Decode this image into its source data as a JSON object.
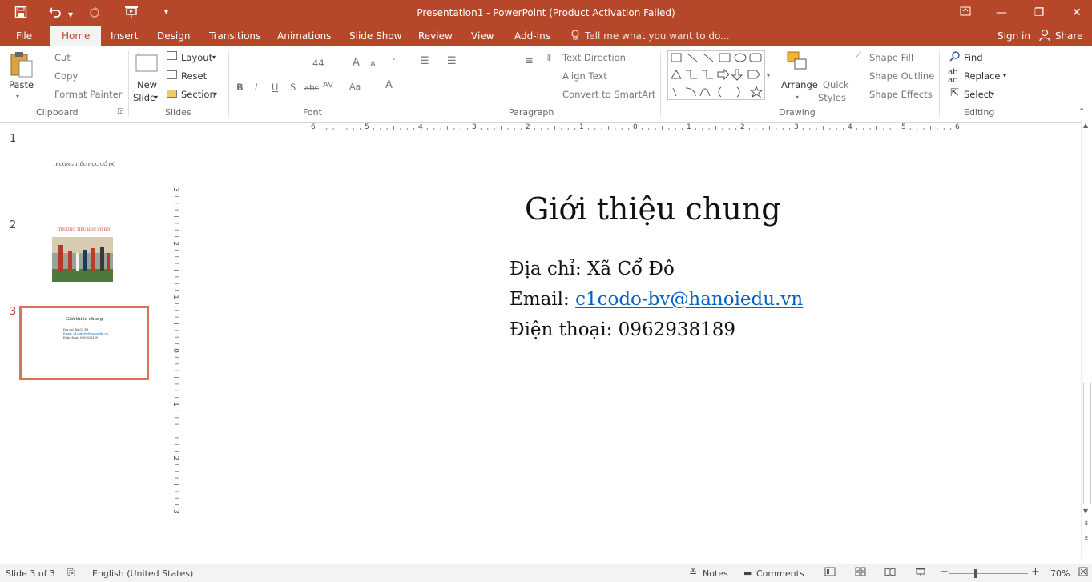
{
  "window": {
    "title": "Presentation1 - PowerPoint (Product Activation Failed)"
  },
  "quick_access": {
    "save_icon": "save-icon",
    "undo_icon": "undo-icon",
    "redo_icon": "redo-icon",
    "present_icon": "present-icon",
    "customize_icon": "chevron-down-icon"
  },
  "tabs": [
    "File",
    "Home",
    "Insert",
    "Design",
    "Transitions",
    "Animations",
    "Slide Show",
    "Review",
    "View",
    "Add-Ins"
  ],
  "tell_me": "Tell me what you want to do...",
  "sign_in": "Sign in",
  "share": "Share",
  "ribbon": {
    "clipboard": {
      "paste": "Paste",
      "cut": "Cut",
      "copy": "Copy",
      "format_painter": "Format Painter",
      "label": "Clipboard"
    },
    "slides": {
      "new": "New",
      "slide": "Slide",
      "layout": "Layout",
      "reset": "Reset",
      "section": "Section",
      "label": "Slides"
    },
    "font": {
      "size": "44",
      "label": "Font",
      "bold": "B",
      "italic": "I",
      "underline": "U",
      "shadow": "S",
      "strike": "abc",
      "spacing": "AV",
      "case": "Aa",
      "grow": "A",
      "shrink": "A",
      "color": "A"
    },
    "paragraph": {
      "text_direction": "Text Direction",
      "align_text": "Align Text",
      "convert": "Convert to SmartArt",
      "label": "Paragraph"
    },
    "drawing": {
      "arrange": "Arrange",
      "quick": "Quick",
      "styles": "Styles",
      "label": "Drawing"
    },
    "shape": {
      "fill": "Shape Fill",
      "outline": "Shape Outline",
      "effects": "Shape Effects"
    },
    "editing": {
      "find": "Find",
      "replace": "Replace",
      "select": "Select",
      "label": "Editing"
    }
  },
  "ruler": {
    "labels": [
      "6",
      "5",
      "4",
      "3",
      "2",
      "1",
      "0",
      "1",
      "2",
      "3",
      "4",
      "5",
      "6"
    ]
  },
  "vruler": {
    "labels": [
      "3",
      "2",
      "1",
      "0",
      "1",
      "2",
      "3"
    ]
  },
  "thumbnails": [
    {
      "num": "1",
      "text": "TRƯỜNG TIỂU HỌC CỔ ĐÔ"
    },
    {
      "num": "2",
      "text": "TRƯỜNG TIỂU HỌC CỔ ĐÔ"
    },
    {
      "num": "3",
      "title": "Giới thiệu chung",
      "lines": [
        "Địa chỉ: Xã Cổ Đô",
        "Email: c1codo-bv@hanoiedu.vn",
        "Điện thoại: 0962938189"
      ]
    }
  ],
  "slide": {
    "title": "Giới thiệu chung",
    "address": "Địa chỉ: Xã Cổ Đô",
    "email_label": "Email: ",
    "email": "c1codo-bv@hanoiedu.vn",
    "phone": "Điện thoại: 0962938189"
  },
  "status": {
    "slide_info": "Slide 3 of 3",
    "language": "English (United States)",
    "notes": "Notes",
    "comments": "Comments",
    "zoom": "70%"
  },
  "colors": {
    "accent": "#b7472a",
    "link": "#0563c1"
  }
}
